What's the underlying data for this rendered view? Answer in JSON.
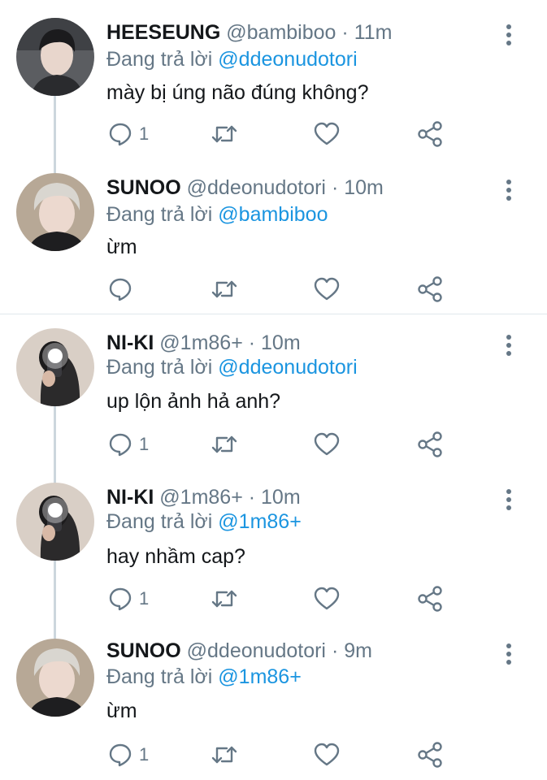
{
  "reply_prefix": "Đang trả lời",
  "tweets": [
    {
      "name": "HEESEUNG",
      "handle": "@bambiboo",
      "dot": "·",
      "time": "11m",
      "reply_to": "@ddeonudotori",
      "text": "mày bị úng não đúng không?",
      "reply_count": "1",
      "avatar_icon": "avatar-heeseung"
    },
    {
      "name": "SUNOO",
      "handle": "@ddeonudotori",
      "dot": "·",
      "time": "10m",
      "reply_to": "@bambiboo",
      "text": "ừm",
      "reply_count": "",
      "avatar_icon": "avatar-sunoo"
    },
    {
      "name": "NI-KI",
      "handle": "@1m86+",
      "dot": "·",
      "time": "10m",
      "reply_to": "@ddeonudotori",
      "text": "up lộn ảnh hả anh?",
      "reply_count": "1",
      "avatar_icon": "avatar-niki"
    },
    {
      "name": "NI-KI",
      "handle": "@1m86+",
      "dot": "·",
      "time": "10m",
      "reply_to": "@1m86+",
      "text": "hay nhầm cap?",
      "reply_count": "1",
      "avatar_icon": "avatar-niki"
    },
    {
      "name": "SUNOO",
      "handle": "@ddeonudotori",
      "dot": "·",
      "time": "9m",
      "reply_to": "@1m86+",
      "text": "ừm",
      "reply_count": "1",
      "avatar_icon": "avatar-sunoo"
    }
  ],
  "icons": {
    "reply": "comment-icon",
    "retweet": "retweet-icon",
    "like": "heart-icon",
    "share": "share-icon",
    "more": "more-vertical-icon"
  },
  "colors": {
    "name": "#14171a",
    "meta": "#657786",
    "mention": "#1b95e0",
    "icon": "#657786",
    "thread_line": "#ccd6dd",
    "divider": "#e1e8ed"
  }
}
